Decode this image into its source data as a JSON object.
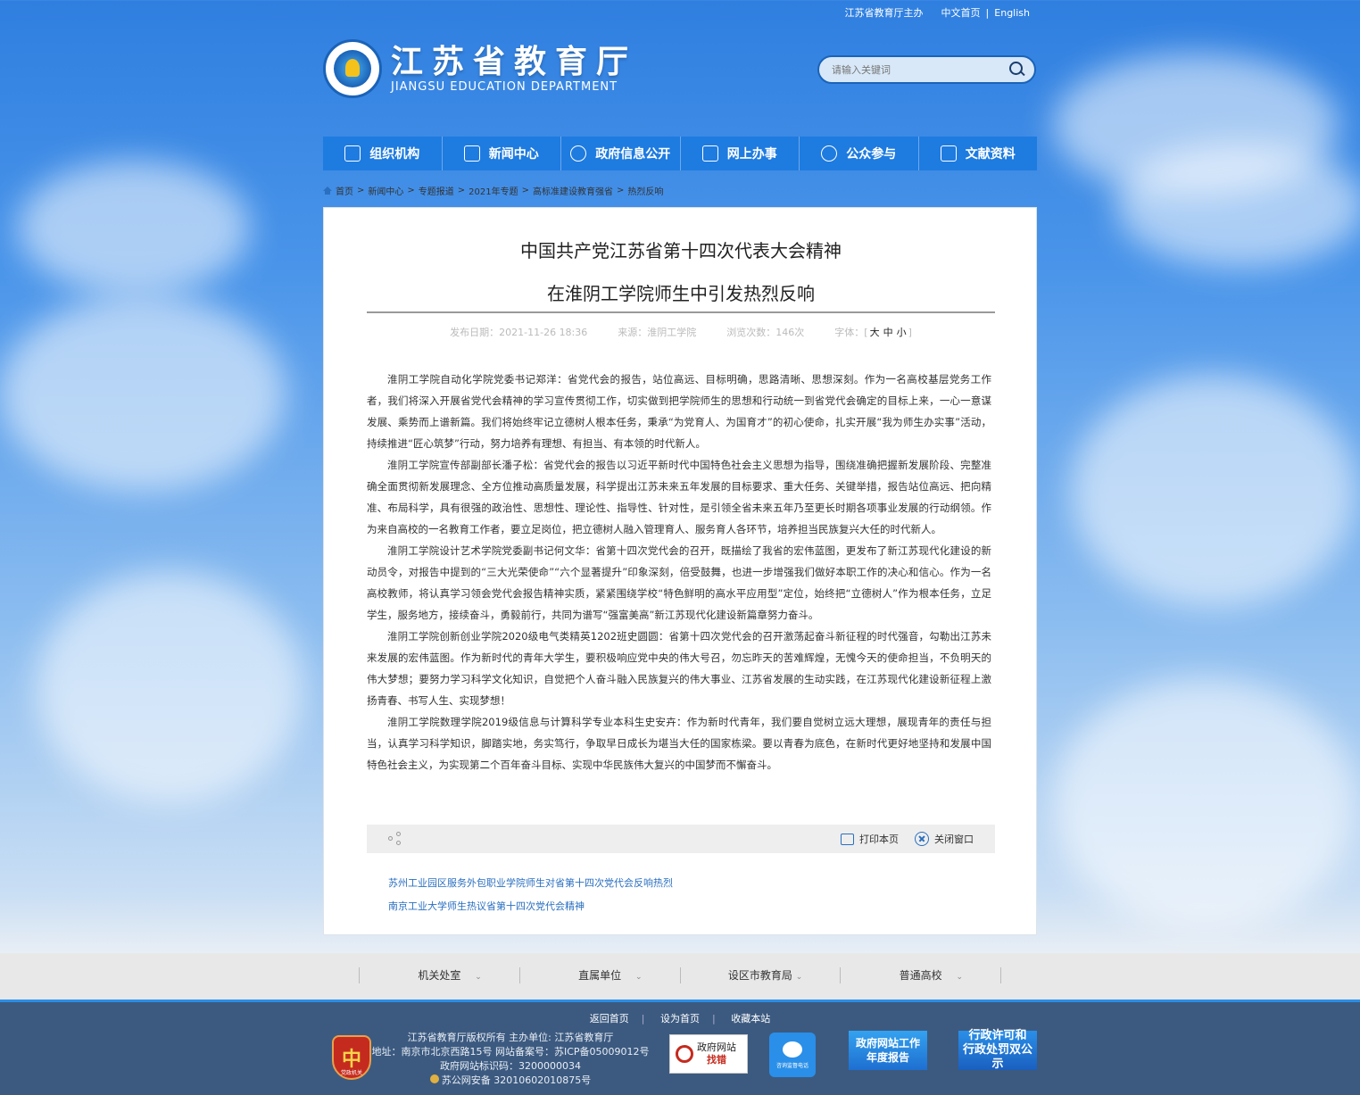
{
  "topbar": {
    "host": "江苏省教育厅主办",
    "cn": "中文首页",
    "sep": "|",
    "en": "English"
  },
  "logo": {
    "cn": "江苏省教育厅",
    "en": "JIANGSU EDUCATION DEPARTMENT"
  },
  "search": {
    "placeholder": "请输入关键词"
  },
  "nav": [
    {
      "label": "组织机构",
      "icon": "org-chart-icon"
    },
    {
      "label": "新闻中心",
      "icon": "document-icon"
    },
    {
      "label": "政府信息公开",
      "icon": "compass-icon"
    },
    {
      "label": "网上办事",
      "icon": "monitor-icon"
    },
    {
      "label": "公众参与",
      "icon": "heart-icon"
    },
    {
      "label": "文献资料",
      "icon": "stack-icon"
    }
  ],
  "breadcrumb": [
    "首页",
    "新闻中心",
    "专题报道",
    "2021年专题",
    "高标准建设教育强省",
    "热烈反响"
  ],
  "article": {
    "title_line1": "中国共产党江苏省第十四次代表大会精神",
    "title_line2": "在淮阴工学院师生中引发热烈反响",
    "meta": {
      "date": "发布日期：2021-11-26 18:36",
      "source": "来源：淮阴工学院",
      "views": "浏览次数：146次",
      "font_label": "字体：[",
      "font_large": "大",
      "font_mid": "中",
      "font_small": "小",
      "font_end": "]"
    },
    "paragraphs": [
      "淮阴工学院自动化学院党委书记郑洋：省党代会的报告，站位高远、目标明确，思路清晰、思想深刻。作为一名高校基层党务工作者，我们将深入开展省党代会精神的学习宣传贯彻工作，切实做到把学院师生的思想和行动统一到省党代会确定的目标上来，一心一意谋发展、乘势而上谱新篇。我们将始终牢记立德树人根本任务，秉承“为党育人、为国育才”的初心使命，扎实开展“我为师生办实事”活动，持续推进“匠心筑梦”行动，努力培养有理想、有担当、有本领的时代新人。",
      "淮阴工学院宣传部副部长潘子松：省党代会的报告以习近平新时代中国特色社会主义思想为指导，围绕准确把握新发展阶段、完整准确全面贯彻新发展理念、全方位推动高质量发展，科学提出江苏未来五年发展的目标要求、重大任务、关键举措，报告站位高远、把向精准、布局科学，具有很强的政治性、思想性、理论性、指导性、针对性，是引领全省未来五年乃至更长时期各项事业发展的行动纲领。作为来自高校的一名教育工作者，要立足岗位，把立德树人融入管理育人、服务育人各环节，培养担当民族复兴大任的时代新人。",
      "淮阴工学院设计艺术学院党委副书记何文华：省第十四次党代会的召开，既描绘了我省的宏伟蓝图，更发布了新江苏现代化建设的新动员令，对报告中提到的“三大光荣使命”“六个显著提升”印象深刻，倍受鼓舞，也进一步增强我们做好本职工作的决心和信心。作为一名高校教师，将认真学习领会党代会报告精神实质，紧紧围绕学校“特色鲜明的高水平应用型”定位，始终把“立德树人”作为根本任务，立足学生，服务地方，接续奋斗，勇毅前行，共同为谱写“强富美高”新江苏现代化建设新篇章努力奋斗。",
      "淮阴工学院创新创业学院2020级电气类精英1202班史圆圆：省第十四次党代会的召开激荡起奋斗新征程的时代强音，勾勒出江苏未来发展的宏伟蓝图。作为新时代的青年大学生，要积极响应党中央的伟大号召，勿忘昨天的苦难辉煌，无愧今天的使命担当，不负明天的伟大梦想；要努力学习科学文化知识，自觉把个人奋斗融入民族复兴的伟大事业、江苏省发展的生动实践，在江苏现代化建设新征程上激扬青春、书写人生、实现梦想！",
      "淮阴工学院数理学院2019级信息与计算科学专业本科生史安卉：作为新时代青年，我们要自觉树立远大理想，展现青年的责任与担当，认真学习科学知识，脚踏实地，务实笃行，争取早日成长为堪当大任的国家栋梁。要以青春为底色，在新时代更好地坚持和发展中国特色社会主义，为实现第二个百年奋斗目标、实现中华民族伟大复兴的中国梦而不懈奋斗。"
    ],
    "tools": {
      "print": "打印本页",
      "close": "关闭窗口"
    },
    "related": [
      "苏州工业园区服务外包职业学院师生对省第十四次党代会反响热烈",
      "南京工业大学师生热议省第十四次党代会精神"
    ]
  },
  "footer_links": [
    "机关处室",
    "直属单位",
    "设区市教育局",
    "普通高校"
  ],
  "footer": {
    "links": [
      "返回首页",
      "设为首页",
      "收藏本站"
    ],
    "link_sep": "|",
    "info": [
      "江苏省教育厅版权所有 主办单位: 江苏省教育厅",
      "地址：南京市北京西路15号 网站备案号：苏ICP备05009012号",
      "政府网站标识码：3200000034",
      "苏公网安备 32010602010875号"
    ],
    "badge": {
      "glyph": "中",
      "caption": "党政机关"
    },
    "box1": {
      "line1": "政府网站",
      "line2": "找错"
    },
    "box2": {
      "caption": "咨询监督电话"
    },
    "box3": {
      "line1": "政府网站工作",
      "line2": "年度报告"
    },
    "box4": {
      "line1": "行政许可和",
      "line2": "行政处罚双公示"
    }
  }
}
